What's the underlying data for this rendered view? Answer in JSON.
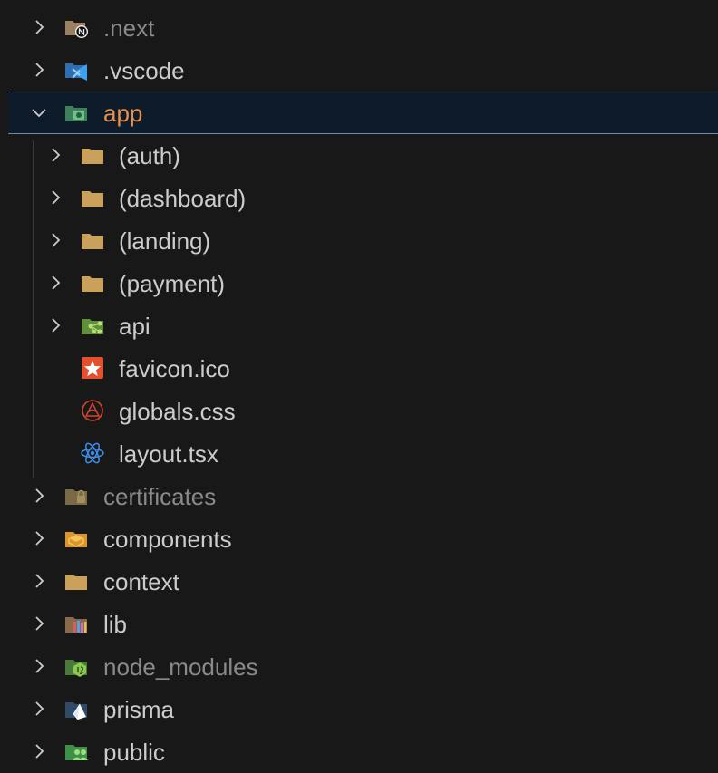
{
  "tree": {
    "items": [
      {
        "label": ".next",
        "icon": "nextjs-folder-icon",
        "state": "collapsed",
        "dimmed": true
      },
      {
        "label": ".vscode",
        "icon": "vscode-folder-icon",
        "state": "collapsed"
      },
      {
        "label": "app",
        "icon": "app-folder-icon",
        "state": "expanded",
        "selected": true
      },
      {
        "label": "(auth)",
        "icon": "folder-icon",
        "state": "collapsed"
      },
      {
        "label": "(dashboard)",
        "icon": "folder-icon",
        "state": "collapsed"
      },
      {
        "label": "(landing)",
        "icon": "folder-icon",
        "state": "collapsed"
      },
      {
        "label": "(payment)",
        "icon": "folder-icon",
        "state": "collapsed"
      },
      {
        "label": "api",
        "icon": "api-folder-icon",
        "state": "collapsed"
      },
      {
        "label": "favicon.ico",
        "icon": "favicon-star-icon"
      },
      {
        "label": "globals.css",
        "icon": "css-icon"
      },
      {
        "label": "layout.tsx",
        "icon": "react-icon"
      },
      {
        "label": "certificates",
        "icon": "certificates-folder-icon",
        "state": "collapsed",
        "dimmed": true
      },
      {
        "label": "components",
        "icon": "components-folder-icon",
        "state": "collapsed"
      },
      {
        "label": "context",
        "icon": "folder-icon",
        "state": "collapsed"
      },
      {
        "label": "lib",
        "icon": "lib-folder-icon",
        "state": "collapsed"
      },
      {
        "label": "node_modules",
        "icon": "node-folder-icon",
        "state": "collapsed",
        "dimmed": true
      },
      {
        "label": "prisma",
        "icon": "prisma-folder-icon",
        "state": "collapsed"
      },
      {
        "label": "public",
        "icon": "public-folder-icon",
        "state": "collapsed"
      }
    ]
  },
  "colors": {
    "background": "#181818",
    "selected_row": "#0d1b2a",
    "selected_label": "#e8914a",
    "folder": "#c9a15a"
  }
}
